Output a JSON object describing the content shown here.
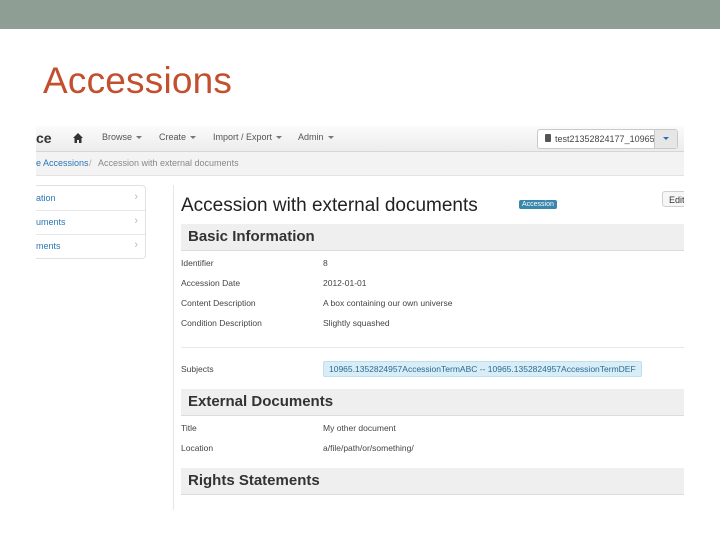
{
  "slide": {
    "title": "Accessions"
  },
  "navbar": {
    "brand": "ce",
    "menu": [
      {
        "label": "Browse"
      },
      {
        "label": "Create"
      },
      {
        "label": "Import / Export"
      },
      {
        "label": "Admin"
      }
    ],
    "repository": "test21352824177_10965"
  },
  "breadcrumb": {
    "parent": "e Accessions",
    "separator": "/",
    "current": "Accession with external documents"
  },
  "sidebar": {
    "items": [
      {
        "label": "ation"
      },
      {
        "label": "uments"
      },
      {
        "label": "ments"
      }
    ]
  },
  "record": {
    "title": "Accession with external documents",
    "badge": "Accession",
    "edit_label": "Edit",
    "sections": {
      "basic": "Basic Information",
      "external": "External Documents",
      "rights": "Rights Statements"
    },
    "fields": [
      {
        "label": "Identifier",
        "value": "8"
      },
      {
        "label": "Accession Date",
        "value": "2012-01-01"
      },
      {
        "label": "Content Description",
        "value": "A box containing our own universe"
      },
      {
        "label": "Condition Description",
        "value": "Slightly squashed"
      }
    ],
    "subjects_label": "Subjects",
    "subject": "10965.1352824957AccessionTermABC -- 10965.1352824957AccessionTermDEF",
    "external_fields": [
      {
        "label": "Title",
        "value": "My other document"
      },
      {
        "label": "Location",
        "value": "a/file/path/or/something/"
      }
    ]
  }
}
